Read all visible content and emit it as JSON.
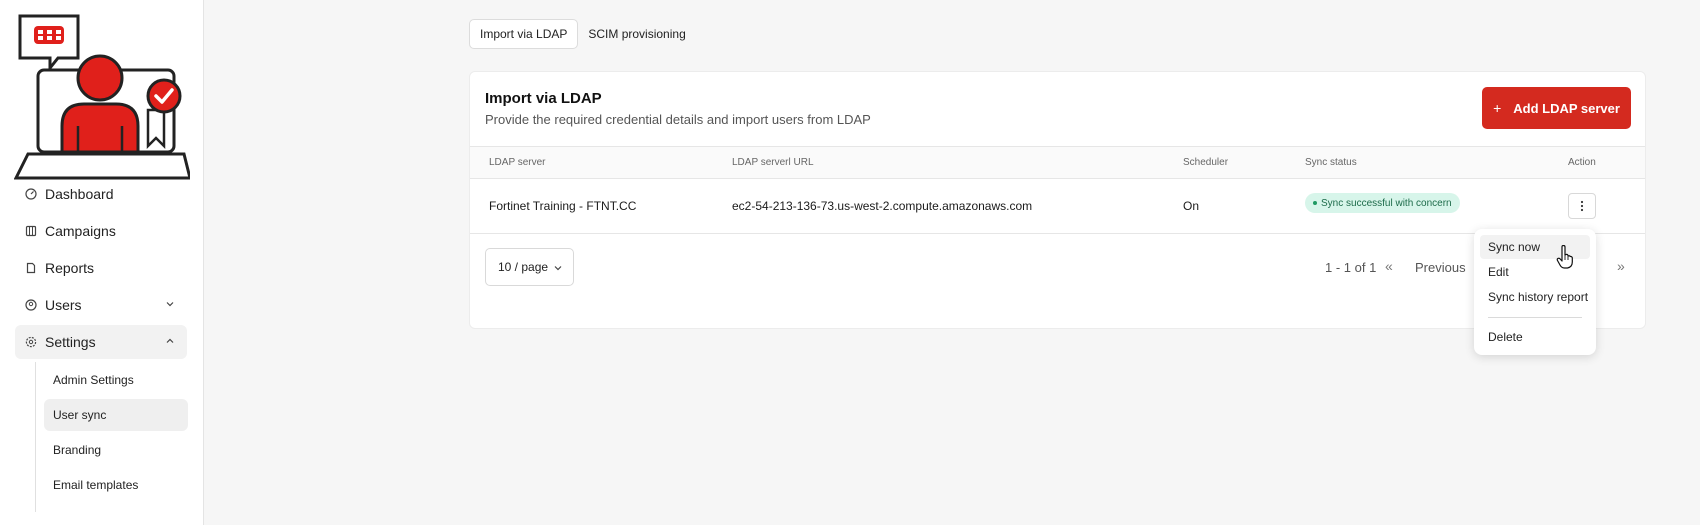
{
  "sidebar": {
    "items": [
      {
        "label": "Dashboard",
        "icon": "gauge-icon"
      },
      {
        "label": "Campaigns",
        "icon": "calendar-icon"
      },
      {
        "label": "Reports",
        "icon": "document-icon"
      },
      {
        "label": "Users",
        "icon": "user-icon"
      },
      {
        "label": "Settings",
        "icon": "gear-icon"
      }
    ],
    "settings_children": [
      "Admin Settings",
      "User sync",
      "Branding",
      "Email templates"
    ]
  },
  "tabs": [
    "Import via LDAP",
    "SCIM provisioning"
  ],
  "card": {
    "title": "Import via LDAP",
    "subtitle": "Provide the required credential details and import users from LDAP",
    "add_button": "Add LDAP server",
    "accent_color": "#d42a1f"
  },
  "table": {
    "headers": [
      "LDAP server",
      "LDAP serverl URL",
      "Scheduler",
      "Sync status",
      "Action"
    ],
    "rows": [
      {
        "server": "Fortinet Training - FTNT.CC",
        "url": "ec2-54-213-136-73.us-west-2.compute.amazonaws.com",
        "scheduler": "On",
        "status": "Sync successful with concern"
      }
    ]
  },
  "pagination": {
    "page_size": "10 / page",
    "range": "1 - 1 of 1",
    "previous": "Previous"
  },
  "action_menu": {
    "items": [
      "Sync now",
      "Edit",
      "Sync history report",
      "Delete"
    ]
  }
}
